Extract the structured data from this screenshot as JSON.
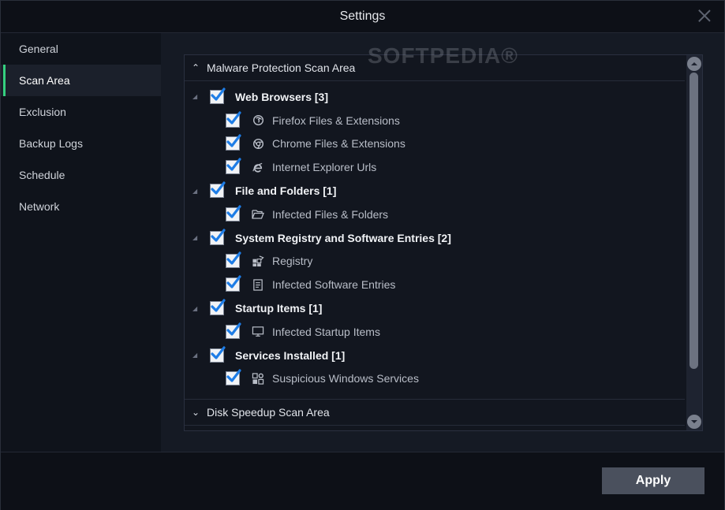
{
  "window": {
    "title": "Settings"
  },
  "sidebar": {
    "items": [
      {
        "label": "General"
      },
      {
        "label": "Scan Area"
      },
      {
        "label": "Exclusion"
      },
      {
        "label": "Backup Logs"
      },
      {
        "label": "Schedule"
      },
      {
        "label": "Network"
      }
    ],
    "active_index": 1
  },
  "scan": {
    "malware_header": "Malware Protection Scan Area",
    "disk_header": "Disk Speedup Scan Area",
    "groups": [
      {
        "label": "Web Browsers [3]",
        "checked": true,
        "children": [
          {
            "label": "Firefox Files & Extensions",
            "icon": "firefox-icon",
            "checked": true
          },
          {
            "label": "Chrome Files & Extensions",
            "icon": "chrome-icon",
            "checked": true
          },
          {
            "label": "Internet Explorer Urls",
            "icon": "ie-icon",
            "checked": true
          }
        ]
      },
      {
        "label": "File and Folders [1]",
        "checked": true,
        "children": [
          {
            "label": "Infected Files & Folders",
            "icon": "folder-icon",
            "checked": true
          }
        ]
      },
      {
        "label": "System Registry and Software Entries [2]",
        "checked": true,
        "children": [
          {
            "label": "Registry",
            "icon": "registry-icon",
            "checked": true
          },
          {
            "label": "Infected Software Entries",
            "icon": "document-icon",
            "checked": true
          }
        ]
      },
      {
        "label": "Startup Items [1]",
        "checked": true,
        "children": [
          {
            "label": "Infected Startup Items",
            "icon": "monitor-icon",
            "checked": true
          }
        ]
      },
      {
        "label": "Services Installed [1]",
        "checked": true,
        "children": [
          {
            "label": "Suspicious Windows Services",
            "icon": "services-icon",
            "checked": true
          }
        ]
      }
    ]
  },
  "footer": {
    "apply_label": "Apply"
  },
  "watermark": "SOFTPEDIA®",
  "colors": {
    "accent": "#35d07f",
    "check": "#1e7de6",
    "background": "#131722"
  }
}
